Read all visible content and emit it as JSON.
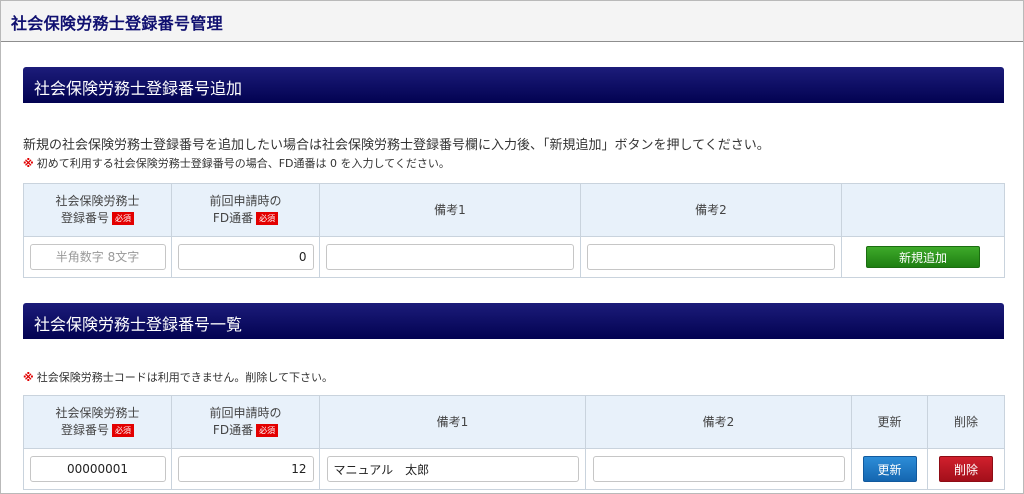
{
  "page": {
    "title": "社会保険労務士登録番号管理"
  },
  "add_section": {
    "title": "社会保険労務士登録番号追加",
    "description": "新規の社会保険労務士登録番号を追加したい場合は社会保険労務士登録番号欄に入力後、「新規追加」ボタンを押してください。",
    "note_mark": "※",
    "note": "初めて利用する社会保険労務士登録番号の場合、FD通番は 0 を入力してください。",
    "headers": {
      "reg_no_line1": "社会保険労務士",
      "reg_no_line2": "登録番号",
      "fd_line1": "前回申請時の",
      "fd_line2": "FD通番",
      "required": "必須",
      "remark1": "備考1",
      "remark2": "備考2"
    },
    "row": {
      "reg_no_placeholder": "半角数字 8文字",
      "reg_no_value": "",
      "fd_value": "0",
      "remark1_value": "",
      "remark2_value": ""
    },
    "add_button": "新規追加"
  },
  "list_section": {
    "title": "社会保険労務士登録番号一覧",
    "note_mark": "※",
    "note": "社会保険労務士コードは利用できません。削除して下さい。",
    "headers": {
      "reg_no_line1": "社会保険労務士",
      "reg_no_line2": "登録番号",
      "fd_line1": "前回申請時の",
      "fd_line2": "FD通番",
      "required": "必須",
      "remark1": "備考1",
      "remark2": "備考2",
      "update": "更新",
      "delete": "削除"
    },
    "rows": [
      {
        "reg_no": "00000001",
        "fd": "12",
        "remark1": "マニュアル　太郎",
        "remark2": "",
        "update_button": "更新",
        "delete_button": "削除"
      }
    ]
  },
  "colors": {
    "section_bar": "#020251",
    "title_text": "#101070",
    "header_cell": "#e8f1fa",
    "required_badge": "#e30000",
    "add_button": "#1e7e12",
    "update_button": "#1566b0",
    "delete_button": "#a30f1a"
  }
}
